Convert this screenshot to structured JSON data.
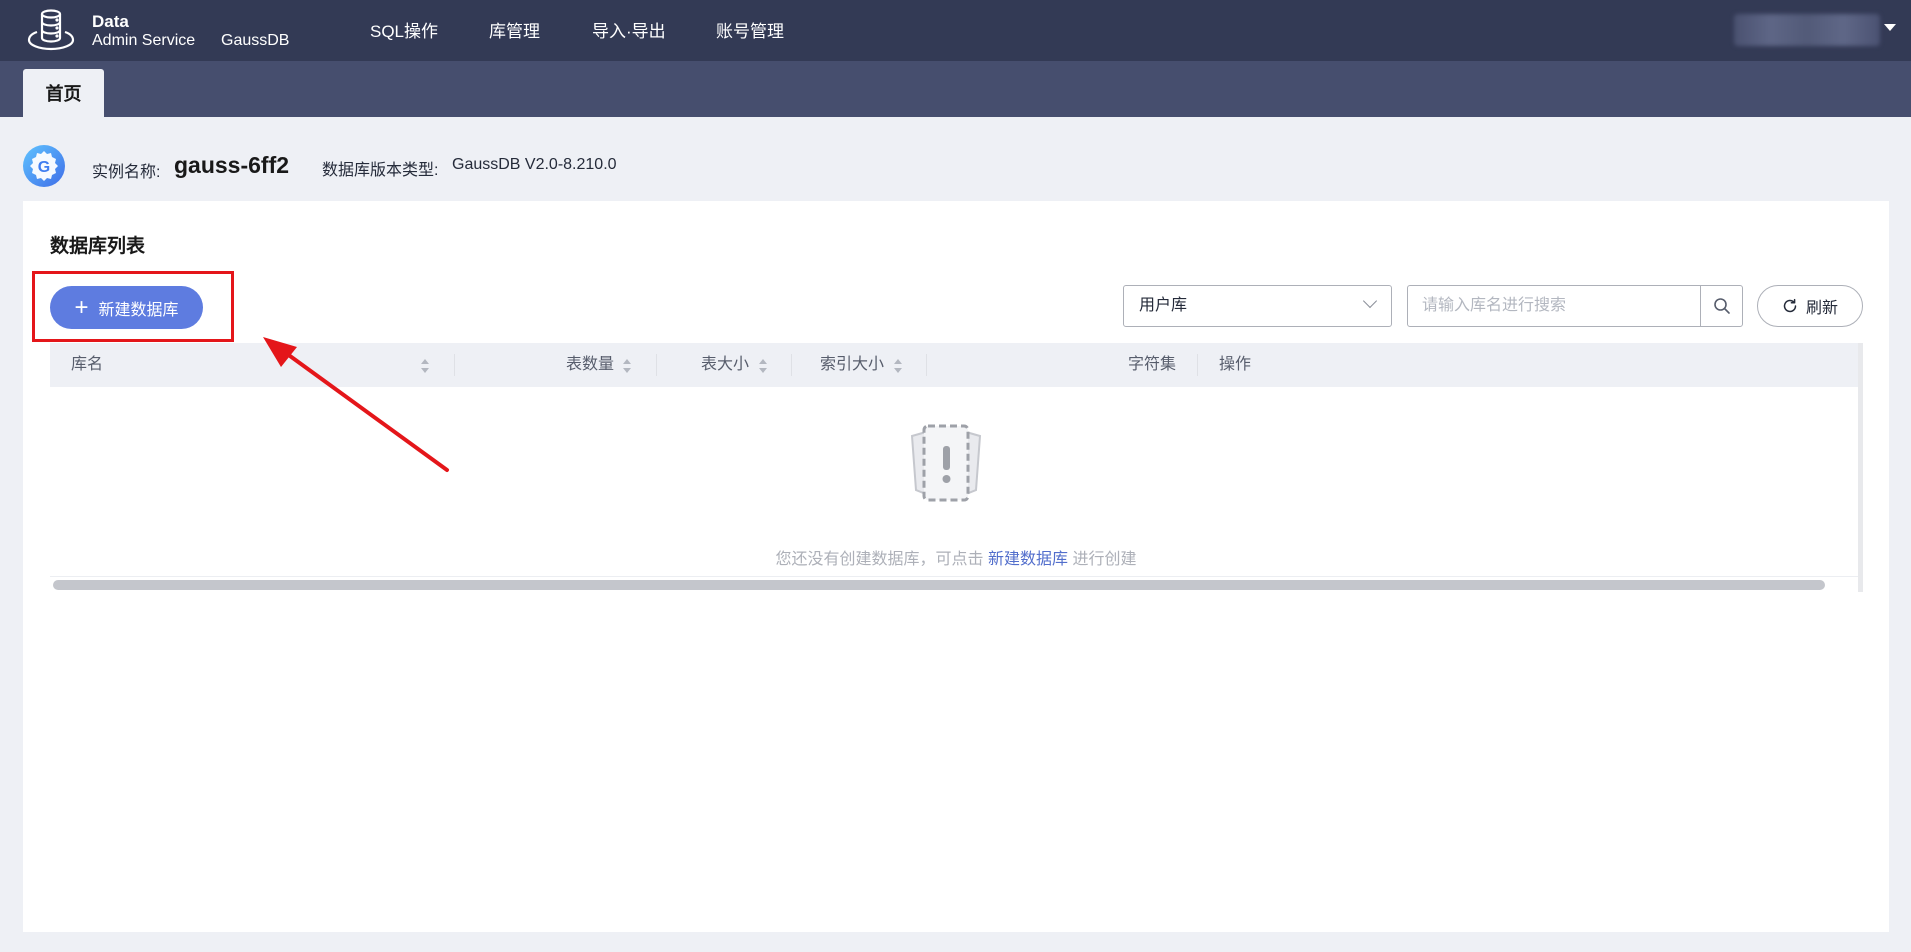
{
  "app": {
    "name_line1": "Data",
    "name_line2": "Admin Service",
    "product": "GaussDB"
  },
  "nav": {
    "items": [
      {
        "label": "SQL操作"
      },
      {
        "label": "库管理"
      },
      {
        "label": "导入·导出"
      },
      {
        "label": "账号管理"
      }
    ]
  },
  "tabs": {
    "home": "首页"
  },
  "instance": {
    "name_label": "实例名称:",
    "name": "gauss-6ff2",
    "version_label": "数据库版本类型:",
    "version": "GaussDB V2.0-8.210.0"
  },
  "db_list": {
    "title": "数据库列表",
    "create_button": "新建数据库",
    "type_select": "用户库",
    "search_placeholder": "请输入库名进行搜索",
    "refresh_button": "刷新",
    "columns": {
      "name": "库名",
      "table_count": "表数量",
      "table_size": "表大小",
      "index_size": "索引大小",
      "charset": "字符集",
      "actions": "操作"
    },
    "empty": {
      "prefix": "您还没有创建数据库，可点击",
      "link": "新建数据库",
      "suffix": "进行创建"
    }
  },
  "colors": {
    "topbar": "#333a55",
    "tabstrip": "#464e6e",
    "primary": "#5e7ce0",
    "annotation_red": "#e4161a"
  },
  "icons": [
    "database-logo-icon",
    "gaussdb-instance-icon",
    "chevron-down-icon",
    "search-icon",
    "refresh-icon",
    "sort-icon",
    "empty-state-icon",
    "annotation-arrow-icon"
  ]
}
